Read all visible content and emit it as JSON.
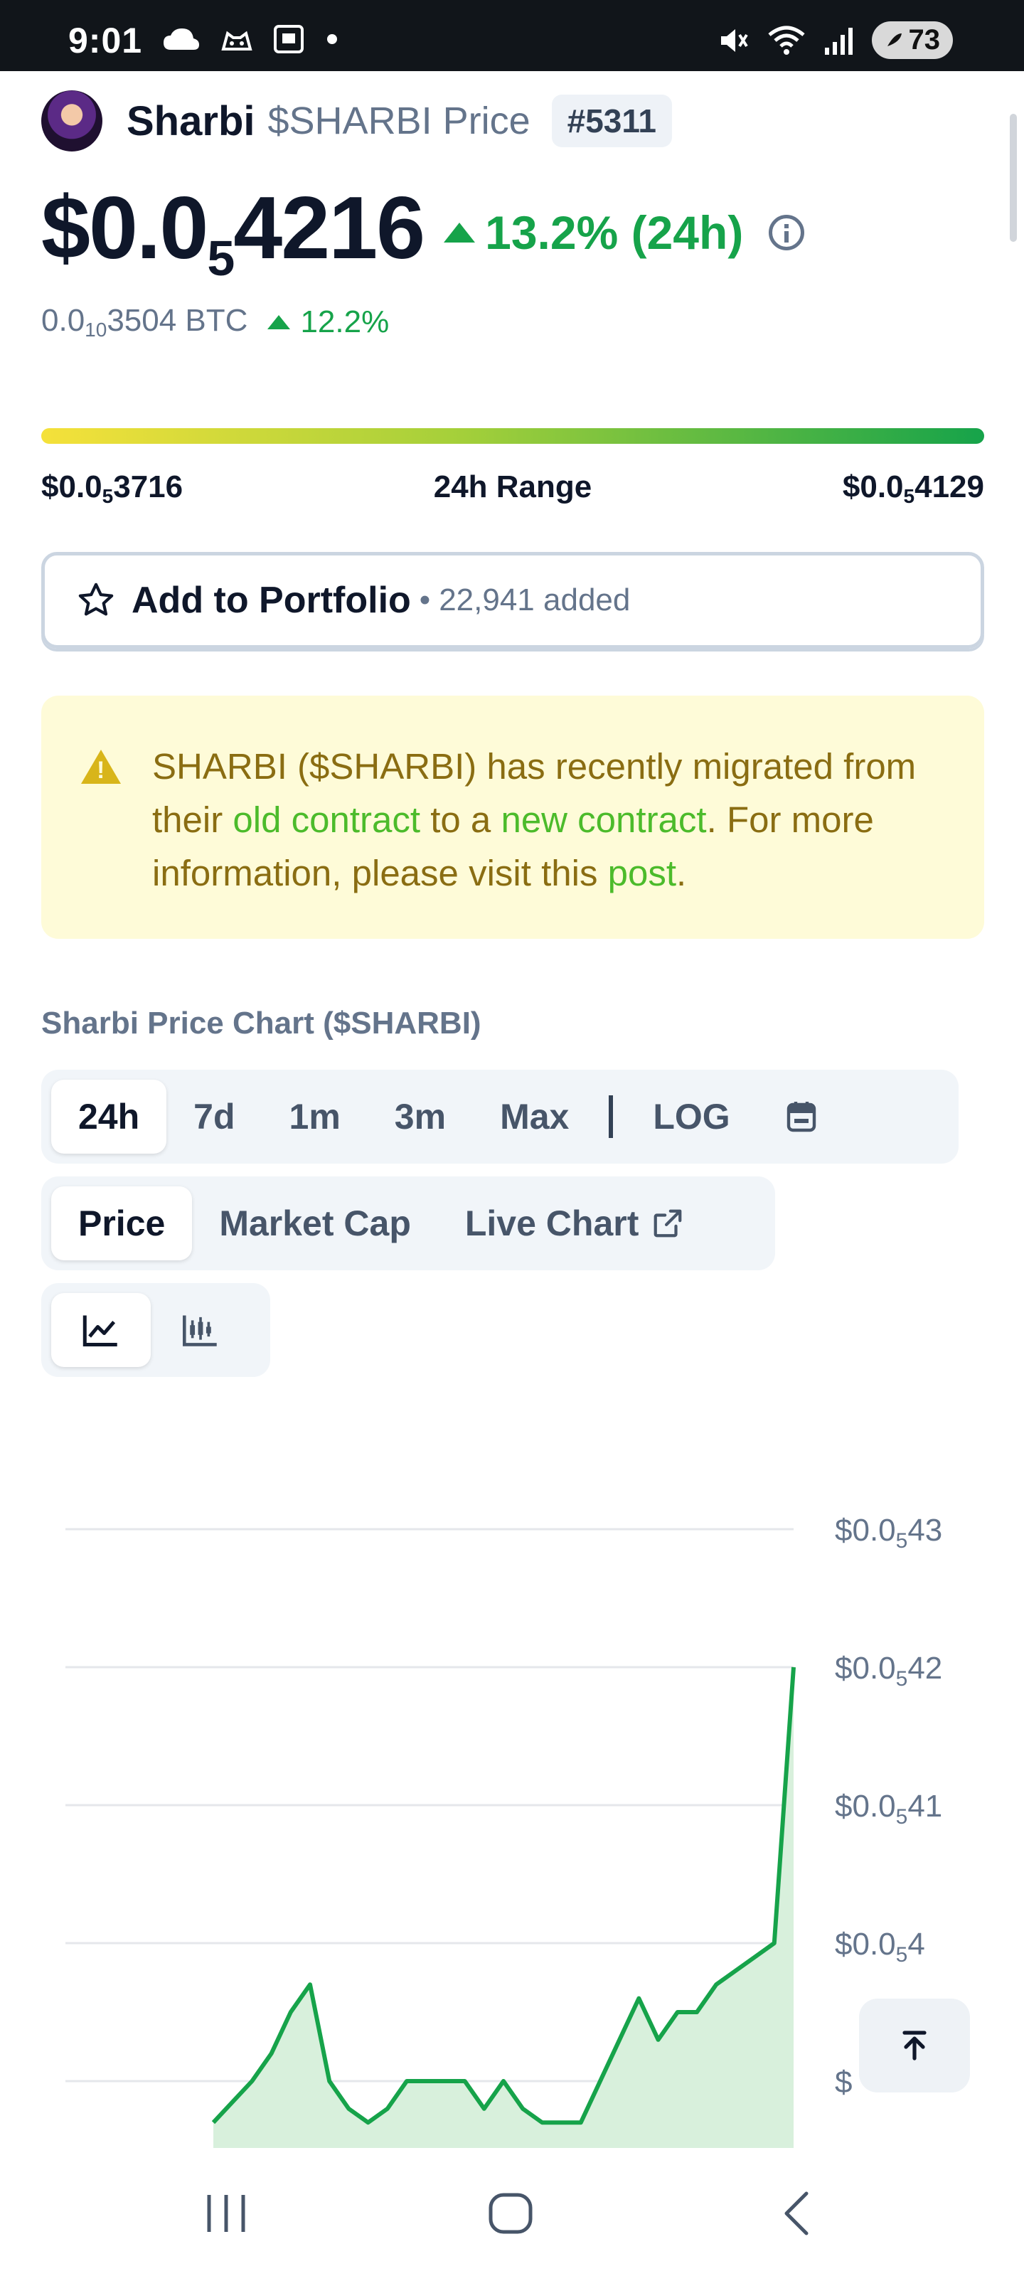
{
  "status_bar": {
    "time": "9:01",
    "left_icons": [
      "cloud-icon",
      "cat-icon",
      "screenshot-icon",
      "dot-icon"
    ],
    "right_icons": [
      "mute-icon",
      "wifi-icon",
      "signal-icon"
    ],
    "battery": "73"
  },
  "header": {
    "coin_name": "Sharbi",
    "symbol_label": "$SHARBI Price",
    "rank": "#5311"
  },
  "price": {
    "main_prefix": "$0.0",
    "main_sub": "5",
    "main_suffix": "4216",
    "change": "13.2% (24h)",
    "btc_prefix": "0.0",
    "btc_sub": "10",
    "btc_suffix": "3504 BTC",
    "btc_change": "12.2%"
  },
  "range": {
    "low_prefix": "$0.0",
    "low_sub": "5",
    "low_suffix": "3716",
    "label": "24h Range",
    "high_prefix": "$0.0",
    "high_sub": "5",
    "high_suffix": "4129",
    "position": 1.0
  },
  "portfolio": {
    "label": "Add to Portfolio",
    "separator": "•",
    "count": "22,941 added"
  },
  "notice": {
    "text_1": "SHARBI ($SHARBI) has recently migrated from their ",
    "link_old": "old contract",
    "text_2": " to a ",
    "link_new": "new contract",
    "text_3": ". For more information, please visit this ",
    "link_post": "post",
    "text_4": "."
  },
  "chart_section": {
    "title": "Sharbi Price Chart ($SHARBI)",
    "ranges": [
      "24h",
      "7d",
      "1m",
      "3m",
      "Max"
    ],
    "log_label": "LOG",
    "views": [
      "Price",
      "Market Cap",
      "Live Chart"
    ]
  },
  "chart_data": {
    "type": "line",
    "title": "",
    "xlabel": "",
    "ylabel": "",
    "y_ticks": [
      {
        "prefix": "$0.0",
        "sub": "5",
        "suffix": "43",
        "value": 4.3e-06
      },
      {
        "prefix": "$0.0",
        "sub": "5",
        "suffix": "42",
        "value": 4.2e-06
      },
      {
        "prefix": "$0.0",
        "sub": "5",
        "suffix": "41",
        "value": 4.1e-06
      },
      {
        "prefix": "$0.0",
        "sub": "5",
        "suffix": "4",
        "value": 4e-06
      },
      {
        "prefix": "$",
        "sub": "",
        "suffix": "",
        "value": 3.9e-06
      }
    ],
    "ylim": [
      3.87e-06,
      4.3e-06
    ],
    "series": [
      {
        "values": [
          3.87e-06,
          3.885e-06,
          3.9e-06,
          3.92e-06,
          3.95e-06,
          3.97e-06,
          3.9e-06,
          3.88e-06,
          3.87e-06,
          3.88e-06,
          3.9e-06,
          3.9e-06,
          3.9e-06,
          3.9e-06,
          3.88e-06,
          3.9e-06,
          3.88e-06,
          3.87e-06,
          3.87e-06,
          3.87e-06,
          3.9e-06,
          3.93e-06,
          3.96e-06,
          3.93e-06,
          3.95e-06,
          3.95e-06,
          3.97e-06,
          3.98e-06,
          3.99e-06,
          4e-06,
          4.2e-06
        ]
      }
    ],
    "grid": true,
    "color": "#16a34a",
    "fill": "#d8f0dc"
  },
  "colors": {
    "green": "#16a34a",
    "notice_bg": "#fefbd8",
    "notice_text": "#8a6d12",
    "link": "#4cbb2b"
  },
  "nav_bar": {
    "items": [
      "recents-icon",
      "home-icon",
      "back-icon"
    ]
  }
}
